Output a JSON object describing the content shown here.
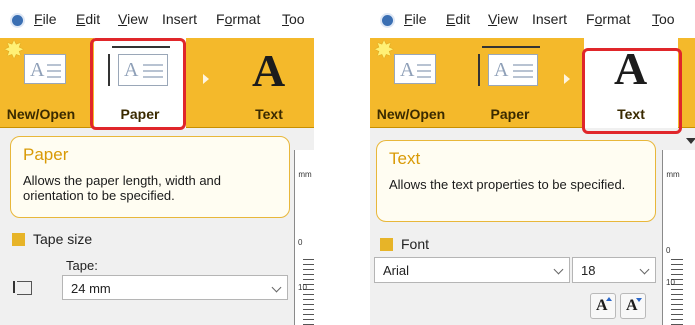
{
  "left_panel": {
    "menu": {
      "items": [
        {
          "label": "File",
          "underline": "F"
        },
        {
          "label": "Edit",
          "underline": "E"
        },
        {
          "label": "View",
          "underline": "V"
        },
        {
          "label": "Insert",
          "underline": ""
        },
        {
          "label": "Format",
          "underline": "o"
        },
        {
          "label": "Too",
          "underline": "T"
        }
      ]
    },
    "ribbon": {
      "new_open_label": "New/Open",
      "paper_label": "Paper",
      "text_label": "Text",
      "text_icon": "A"
    },
    "info": {
      "title": "Paper",
      "description": "Allows the paper length, width and orientation to be specified."
    },
    "section": {
      "label": "Tape size"
    },
    "tape": {
      "label": "Tape:",
      "value": "24 mm"
    },
    "ruler": {
      "unit": "mm",
      "n0": "0",
      "n10": "10"
    }
  },
  "right_panel": {
    "menu": {
      "items": [
        {
          "label": "File",
          "underline": "F"
        },
        {
          "label": "Edit",
          "underline": "E"
        },
        {
          "label": "View",
          "underline": "V"
        },
        {
          "label": "Insert",
          "underline": ""
        },
        {
          "label": "Format",
          "underline": "o"
        },
        {
          "label": "Too",
          "underline": "T"
        }
      ]
    },
    "ribbon": {
      "new_open_label": "New/Open",
      "paper_label": "Paper",
      "text_label": "Text",
      "text_icon": "A"
    },
    "info": {
      "title": "Text",
      "description": "Allows the text properties to be specified."
    },
    "section": {
      "label": "Font"
    },
    "font": {
      "name": "Arial",
      "size": "18"
    },
    "font_buttons": {
      "grow_glyph": "A",
      "shrink_glyph": "A"
    },
    "ruler": {
      "unit": "mm",
      "n0": "0",
      "n10": "10"
    }
  },
  "colors": {
    "ribbon": "#f4b92b",
    "highlight": "#e0262a",
    "accent": "#d99a06"
  },
  "icons": [
    "app-icon",
    "new-open-icon",
    "paper-icon",
    "text-icon",
    "tape-icon",
    "font-grow-icon",
    "font-shrink-icon"
  ]
}
